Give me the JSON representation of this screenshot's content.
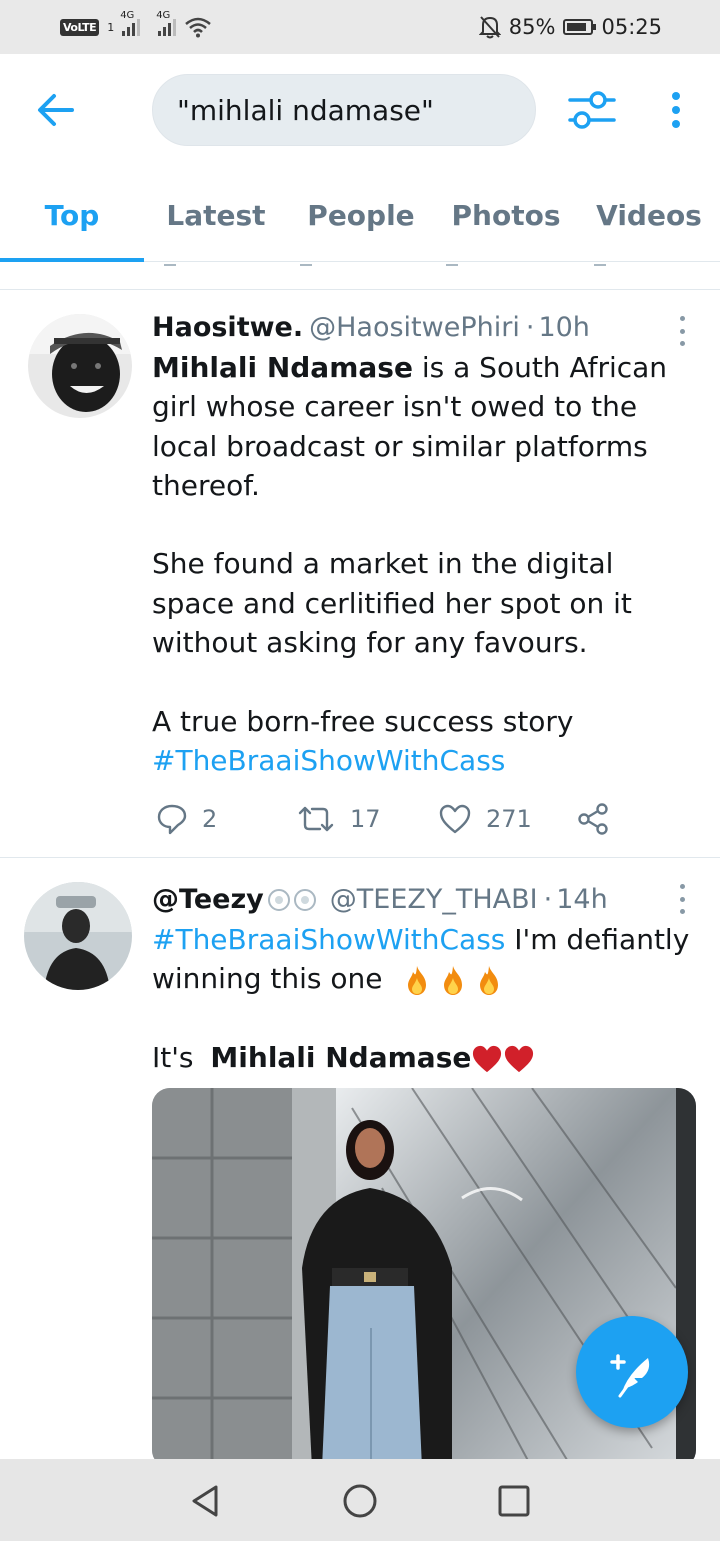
{
  "status_bar": {
    "volte": "VoLTE",
    "sim": "1",
    "net1": "4G",
    "net2": "4G",
    "battery": "85%",
    "time": "05:25"
  },
  "search": {
    "query": "\"mihlali ndamase\""
  },
  "tabs": [
    {
      "label": "Top",
      "active": true
    },
    {
      "label": "Latest",
      "active": false
    },
    {
      "label": "People",
      "active": false
    },
    {
      "label": "Photos",
      "active": false
    },
    {
      "label": "Videos",
      "active": false
    }
  ],
  "tweets": [
    {
      "name": "Haositwe.",
      "handle": "@HaositwePhiri",
      "time": "10h",
      "text": {
        "bold": "Mihlali Ndamase",
        "p1_rest": " is a South African girl whose career isn't owed to the local broadcast or similar platforms thereof.",
        "p2": "She found a market in the digital space and cerlitified her spot on it without asking for any favours.",
        "p3": "A true born-free success story",
        "hashtag": "#TheBraaiShowWithCass"
      },
      "replies": "2",
      "retweets": "17",
      "likes": "271"
    },
    {
      "name": "@Teezy",
      "handle": "@TEEZY_THABI",
      "time": "14h",
      "text": {
        "hashtag": "#TheBraaiShowWithCass",
        "after_hashtag": " I'm defiantly winning this one",
        "line2_prefix": "It's ",
        "line2_bold": "Mihlali Ndamase"
      }
    }
  ],
  "colors": {
    "accent": "#1da1f2",
    "text": "#14171a",
    "secondary": "#657786"
  }
}
